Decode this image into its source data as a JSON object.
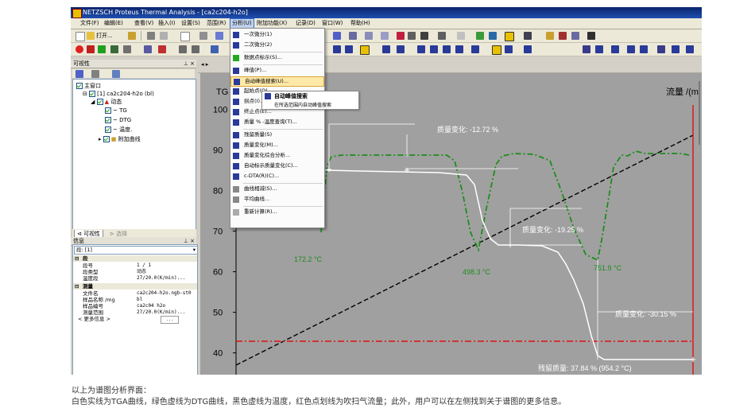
{
  "window": {
    "title": "NETZSCH Proteus Thermal Analysis - [ca2c204-h2o]"
  },
  "menubar": [
    "文件(F)",
    "编辑(E)",
    "查看(V)",
    "插入(I)",
    "设置(S)",
    "范围(R)",
    "分析(U)",
    "附加功能(X)",
    "记录(D)",
    "窗口(W)",
    "帮助(H)"
  ],
  "toolbar": {
    "open_label": "打开..."
  },
  "visibility_pane": {
    "title": "可视性",
    "tree": [
      "主窗口",
      "[1] ca2c204-h2o (bl)",
      "动态",
      "TG",
      "DTG",
      "温度.",
      "附加曲线"
    ]
  },
  "tabs": [
    "可视性",
    "选择"
  ],
  "info_pane": {
    "title": "信息",
    "segment_select": "段: [1]",
    "sections": [
      {
        "title": "段",
        "rows": [
          [
            "段号",
            "1 / 1"
          ],
          [
            "段类型",
            "动态"
          ],
          [
            "温度段",
            "27/20.0(K/min)..."
          ]
        ]
      },
      {
        "title": "测量",
        "rows": [
          [
            "文件名",
            "ca2c204-h2o.ngb-st0"
          ],
          [
            "样品名称 /mg",
            "bl"
          ],
          [
            "样品编号",
            "ca2c04 h2o"
          ],
          [
            "测量范围",
            "27/20.0(K/min)..."
          ],
          [
            "< 更多信息 >",
            "..."
          ]
        ]
      }
    ]
  },
  "analysis_menu": {
    "items": [
      "一次微分(1)",
      "二次微分(2)",
      "数据点标示(S)...",
      "峰值(P)...",
      "自动峰值搜索(U)...",
      "起始点(O)...",
      "拐点(I)...",
      "终止点(E)...",
      "质量 % -温度查询(T)...",
      "残留质量(S)",
      "质量变化(M)...",
      "质量变化综合分析...",
      "自动标示质量变化(C)...",
      "c-DTA(R)(C)...",
      "曲线相减(S)...",
      "平均曲线...",
      "重新计算(R)..."
    ],
    "highlighted_index": 4
  },
  "tooltip": {
    "title": "自动峰值搜索",
    "description": "在所选范围内自动峰值搜索"
  },
  "chart_data": {
    "type": "line",
    "ylabel_left": "TG",
    "ylabel_right": "流量 /(m",
    "y_ticks": [
      40,
      50,
      60,
      70,
      80,
      90,
      100
    ],
    "ylim": [
      36,
      106
    ],
    "series": [
      {
        "name": "TG",
        "color": "#ffffff",
        "style": "solid"
      },
      {
        "name": "DTG",
        "color": "#1e8c1e",
        "style": "dash-dot"
      },
      {
        "name": "温度",
        "color": "#000000",
        "style": "dashed"
      },
      {
        "name": "吹扫气流量",
        "color": "#e00000",
        "style": "dash-dot"
      }
    ],
    "annotations": [
      "质量变化: -12.72 %",
      "质量变化: -19.25 %",
      "质量变化: -30.15 %",
      "残留质量: 37.84 % (954.2 °C)",
      "172.2 °C",
      "498.3 °C",
      "751.9 °C"
    ]
  },
  "caption": {
    "line1": "以上为谱图分析界面：",
    "line2": "白色实线为TGA曲线，绿色虚线为DTG曲线，黑色虚线为温度，红色点划线为吹扫气流量；此外，用户可以在左侧找到关于谱图的更多信息。"
  }
}
